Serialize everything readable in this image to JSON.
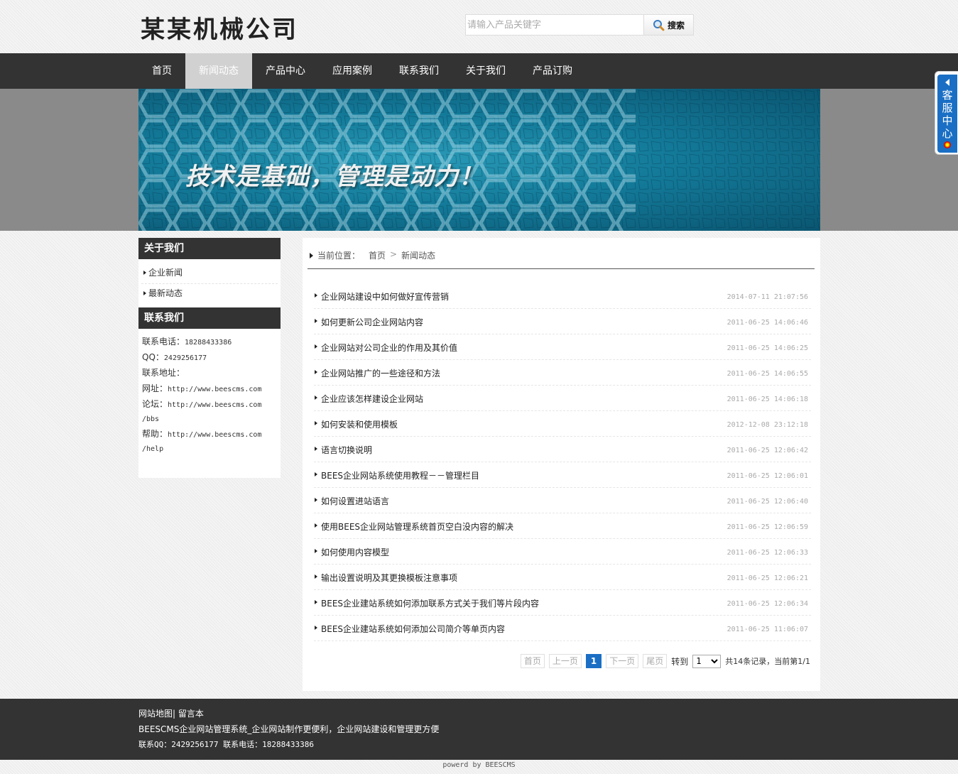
{
  "header": {
    "logo": "某某机械公司",
    "search": {
      "placeholder": "请输入产品关键字",
      "button_label": "搜索"
    }
  },
  "nav": [
    {
      "label": "首页",
      "active": false
    },
    {
      "label": "新闻动态",
      "active": true
    },
    {
      "label": "产品中心",
      "active": false
    },
    {
      "label": "应用案例",
      "active": false
    },
    {
      "label": "联系我们",
      "active": false
    },
    {
      "label": "关于我们",
      "active": false
    },
    {
      "label": "产品订购",
      "active": false
    }
  ],
  "banner": {
    "slogan": "技术是基础，管理是动力！"
  },
  "service": {
    "label": "客服中心"
  },
  "sidebar": {
    "about": {
      "title": "关于我们",
      "items": [
        {
          "label": "企业新闻"
        },
        {
          "label": "最新动态"
        }
      ]
    },
    "contact": {
      "title": "联系我们",
      "phone_label": "联系电话：",
      "phone": "18288433386",
      "qq_label": "QQ：",
      "qq": "2429256177",
      "address_label": "联系地址：",
      "site_label": "网址：",
      "site": "http://www.beescms.com",
      "forum_label": "论坛：",
      "forum": "http://www.beescms.com",
      "forum_cont": "/bbs",
      "help_label": "帮助：",
      "help": "http://www.beescms.com",
      "help_cont": "/help"
    }
  },
  "breadcrumb": {
    "label": "当前位置：",
    "home": "首页",
    "sep": ">",
    "current": "新闻动态"
  },
  "news": [
    {
      "title": "企业网站建设中如何做好宣传营销",
      "date": "2014-07-11 21:07:56"
    },
    {
      "title": "如何更新公司企业网站内容",
      "date": "2011-06-25 14:06:46"
    },
    {
      "title": "企业网站对公司企业的作用及其价值",
      "date": "2011-06-25 14:06:25"
    },
    {
      "title": "企业网站推广的一些途径和方法",
      "date": "2011-06-25 14:06:55"
    },
    {
      "title": "企业应该怎样建设企业网站",
      "date": "2011-06-25 14:06:18"
    },
    {
      "title": "如何安装和使用模板",
      "date": "2012-12-08 23:12:18"
    },
    {
      "title": "语言切换说明",
      "date": "2011-06-25 12:06:42"
    },
    {
      "title": "BEES企业网站系统使用教程－－管理栏目",
      "date": "2011-06-25 12:06:01"
    },
    {
      "title": "如何设置进站语言",
      "date": "2011-06-25 12:06:40"
    },
    {
      "title": "使用BEES企业网站管理系统首页空白没内容的解决",
      "date": "2011-06-25 12:06:59"
    },
    {
      "title": "如何使用内容模型",
      "date": "2011-06-25 12:06:33"
    },
    {
      "title": "输出设置说明及其更换模板注意事项",
      "date": "2011-06-25 12:06:21"
    },
    {
      "title": "BEES企业建站系统如何添加联系方式关于我们等片段内容",
      "date": "2011-06-25 12:06:34"
    },
    {
      "title": "BEES企业建站系统如何添加公司简介等单页内容",
      "date": "2011-06-25 11:06:07"
    }
  ],
  "pager": {
    "first": "首页",
    "prev": "上一页",
    "current": "1",
    "next": "下一页",
    "last": "尾页",
    "goto_label": "转到",
    "goto_value": "1",
    "info": "共14条记录，当前第1/1"
  },
  "footer": {
    "sitemap": "网站地图",
    "sep": "|",
    "guestbook": "留言本",
    "tagline": "BEESCMS企业网站管理系统_企业网站制作更便利，企业网站建设和管理更方便",
    "contact_line": "联系QQ：2429256177 联系电话：18288433386",
    "powered": "powerd by BEESCMS"
  }
}
